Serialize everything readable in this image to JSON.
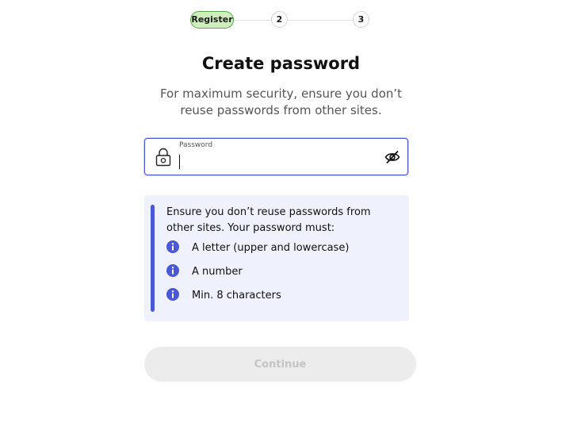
{
  "stepper": {
    "step1_label": "Register",
    "step2_label": "2",
    "step3_label": "3"
  },
  "header": {
    "title": "Create password",
    "subtitle": "For maximum security, ensure you don’t reuse passwords from other sites."
  },
  "password_field": {
    "label": "Password",
    "value": "",
    "lock_icon": "lock-icon",
    "toggle_icon": "eye-slash-icon"
  },
  "requirements": {
    "intro": "Ensure you don’t reuse passwords from other sites. Your password must:",
    "items": [
      {
        "icon": "info-icon",
        "text": "A letter (upper and lowercase)"
      },
      {
        "icon": "info-icon",
        "text": "A number"
      },
      {
        "icon": "info-icon",
        "text": "Min. 8 characters"
      }
    ]
  },
  "continue_button": {
    "label": "Continue",
    "enabled": false
  },
  "colors": {
    "accent": "#4b58d6",
    "active_step_bg": "#cfeebd",
    "requirements_bg": "#eff1fd",
    "disabled_button_bg": "#ececec"
  }
}
